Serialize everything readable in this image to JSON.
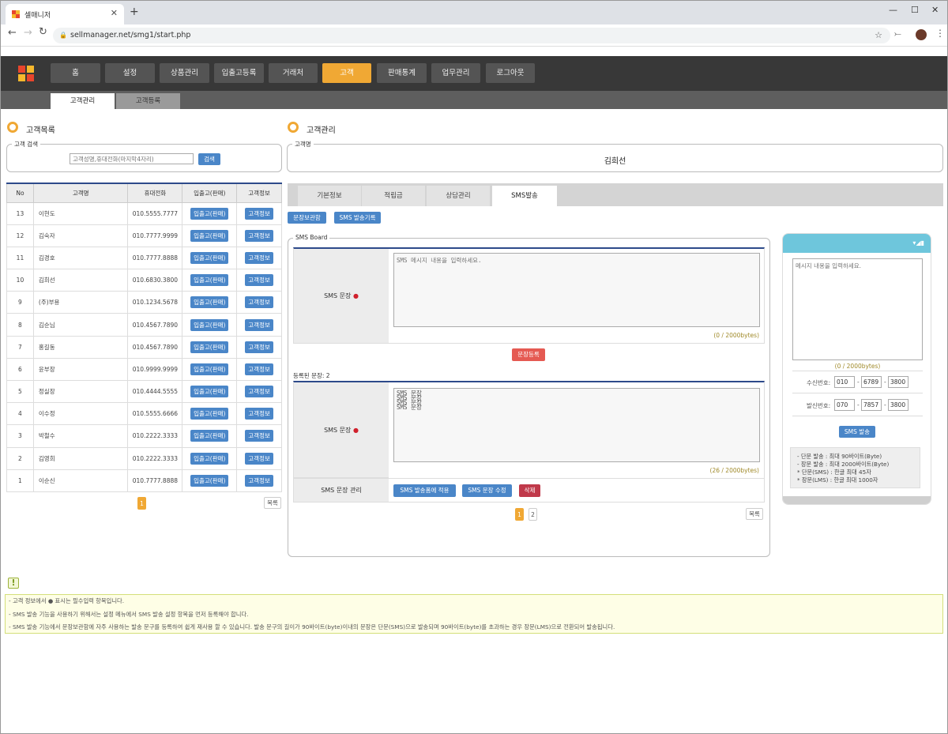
{
  "browser": {
    "tab_title": "셀매니저",
    "url": "sellmanager.net/smg1/start.php"
  },
  "app": {
    "menu": [
      "홈",
      "설정",
      "상품관리",
      "입출고등록",
      "거래처",
      "고객",
      "판매통계",
      "업무관리",
      "로그아웃"
    ],
    "active_menu": "고객",
    "submenu": [
      "고객관리",
      "고객등록"
    ],
    "active_submenu": "고객관리",
    "brand_colors": {
      "active": "#f0a834",
      "button": "#4a86c8",
      "nav": "#383838"
    }
  },
  "left": {
    "title": "고객목록",
    "search_legend": "고객 검색",
    "search_placeholder": "고객성명,휴대전화(마지막4자리)",
    "search_button": "검색",
    "table": {
      "headers": [
        "No",
        "고객명",
        "휴대전화",
        "입출고(판매)",
        "고객정보"
      ],
      "rows": [
        {
          "no": "13",
          "name": "이현도",
          "phone": "010.5555.7777"
        },
        {
          "no": "12",
          "name": "김숙자",
          "phone": "010.7777.9999"
        },
        {
          "no": "11",
          "name": "김경호",
          "phone": "010.7777.8888"
        },
        {
          "no": "10",
          "name": "김희선",
          "phone": "010.6830.3800"
        },
        {
          "no": "9",
          "name": "(주)부용",
          "phone": "010.1234.5678"
        },
        {
          "no": "8",
          "name": "김순님",
          "phone": "010.4567.7890"
        },
        {
          "no": "7",
          "name": "홍길동",
          "phone": "010.4567.7890"
        },
        {
          "no": "6",
          "name": "윤부장",
          "phone": "010.9999.9999"
        },
        {
          "no": "5",
          "name": "정실장",
          "phone": "010.4444.5555"
        },
        {
          "no": "4",
          "name": "이수정",
          "phone": "010.5555.6666"
        },
        {
          "no": "3",
          "name": "박철수",
          "phone": "010.2222.3333"
        },
        {
          "no": "2",
          "name": "김영희",
          "phone": "010.2222.3333"
        },
        {
          "no": "1",
          "name": "이순신",
          "phone": "010.7777.8888"
        }
      ],
      "row_button_1": "입출고(판매)",
      "row_button_2": "고객정보"
    },
    "page": "1",
    "list_button": "목록"
  },
  "right": {
    "title": "고객관리",
    "customer_legend": "고객명",
    "customer_name": "김희선",
    "tabs": [
      "기본정보",
      "적립금",
      "상담관리",
      "SMS발송"
    ],
    "active_tab": "SMS발송",
    "top_buttons": [
      "문장보관함",
      "SMS 발송기록"
    ],
    "board_legend": "SMS Board",
    "sms_label": "SMS 문장",
    "sms_placeholder": "SMS 메시지 내용을 입력하세요.",
    "sms_bytes": "(0 / 2000bytes)",
    "register_button": "문장등록",
    "registered_label": "등록된 문장: 2",
    "saved_label": "SMS 문장",
    "saved_text": "SMS 문장\nSMS 문장\nSMS 문장\nSMS 문장",
    "saved_bytes": "(26 / 2000bytes)",
    "manage_label": "SMS 문장 관리",
    "manage_buttons": [
      "SMS 발송폼에 적용",
      "SMS 문장 수정",
      "삭제"
    ],
    "pages": [
      "1",
      "2"
    ],
    "current_page": "1",
    "list_button": "목록"
  },
  "phone": {
    "status_icons": "▾◢▮",
    "message_placeholder": "메시지 내용을 입력하세요.",
    "bytes": "(0 / 2000bytes)",
    "receiver_label": "수신번호:",
    "receiver": [
      "010",
      "6789",
      "3800"
    ],
    "sender_label": "발신번호:",
    "sender": [
      "070",
      "7857",
      "3800"
    ],
    "send_button": "SMS 발송",
    "info": [
      "- 단문 발송 : 최대 90바이트(Byte)",
      "- 장문 발송 : 최대 2000바이트(Byte)",
      "* 단문(SMS) : 한글 최대 45자",
      "* 장문(LMS) : 한글 최대 1000자"
    ]
  },
  "notice": {
    "lines": [
      "- 고객 정보에서 ● 표시는 필수입력 항목입니다.",
      "- SMS 발송 기능을 사용하기 위해서는 설정 메뉴에서 SMS 발송 설정 항목을 먼저 등록해야 합니다.",
      "- SMS 발송 기능에서 문장보관함에 자주 사용하는 발송 문구를 등록하여 쉽게 재사용 할 수 있습니다. 발송 문구의 길이가 90바이트(byte)이내의 문장은 단문(SMS)으로 발송되며 90바이트(byte)를 초과하는 경우 장문(LMS)으로 전환되어 발송됩니다."
    ]
  }
}
